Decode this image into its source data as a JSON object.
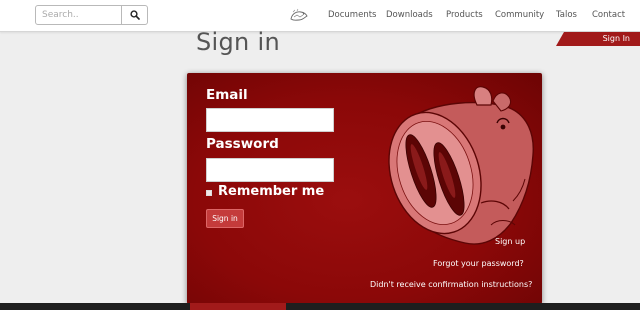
{
  "header": {
    "search": {
      "placeholder": "Search..",
      "value": ""
    },
    "nav": [
      "Documents",
      "Downloads",
      "Products",
      "Community",
      "Talos",
      "Contact"
    ],
    "active_tab": "Sign In"
  },
  "page": {
    "title": "Sign in"
  },
  "form": {
    "email_label": "Email",
    "email_value": "",
    "password_label": "Password",
    "password_value": "",
    "remember_label": "Remember me",
    "remember_checked": false,
    "submit_label": "Sign in"
  },
  "links": {
    "sign_up": "Sign up",
    "forgot_password": "Forgot your password?",
    "confirmation": "Didn't receive confirmation instructions?"
  },
  "colors": {
    "accent": "#a11a1a",
    "card": "#8b0808",
    "page_bg": "#eeeeee"
  }
}
